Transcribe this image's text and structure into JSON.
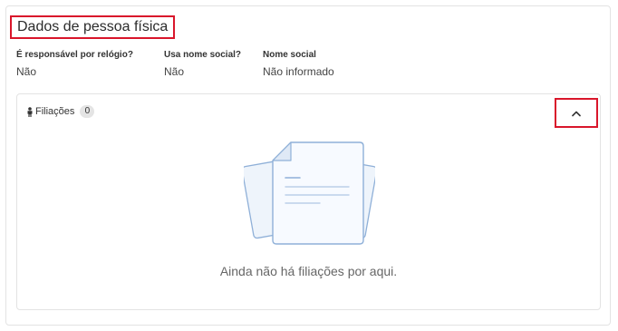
{
  "section": {
    "title": "Dados de pessoa física"
  },
  "fields": [
    {
      "label": "É responsável por relógio?",
      "value": "Não"
    },
    {
      "label": "Usa nome social?",
      "value": "Não"
    },
    {
      "label": "Nome social",
      "value": "Não informado"
    }
  ],
  "filiacoes": {
    "title": "Filiações",
    "count": "0",
    "empty_message": "Ainda não há filiações por aqui.",
    "collapse_icon": "chevron-up-icon",
    "header_icon": "person-icon"
  },
  "colors": {
    "highlight": "#d9162b",
    "illustration_stroke": "#8fb0d8",
    "illustration_fill": "#eef4fb"
  }
}
